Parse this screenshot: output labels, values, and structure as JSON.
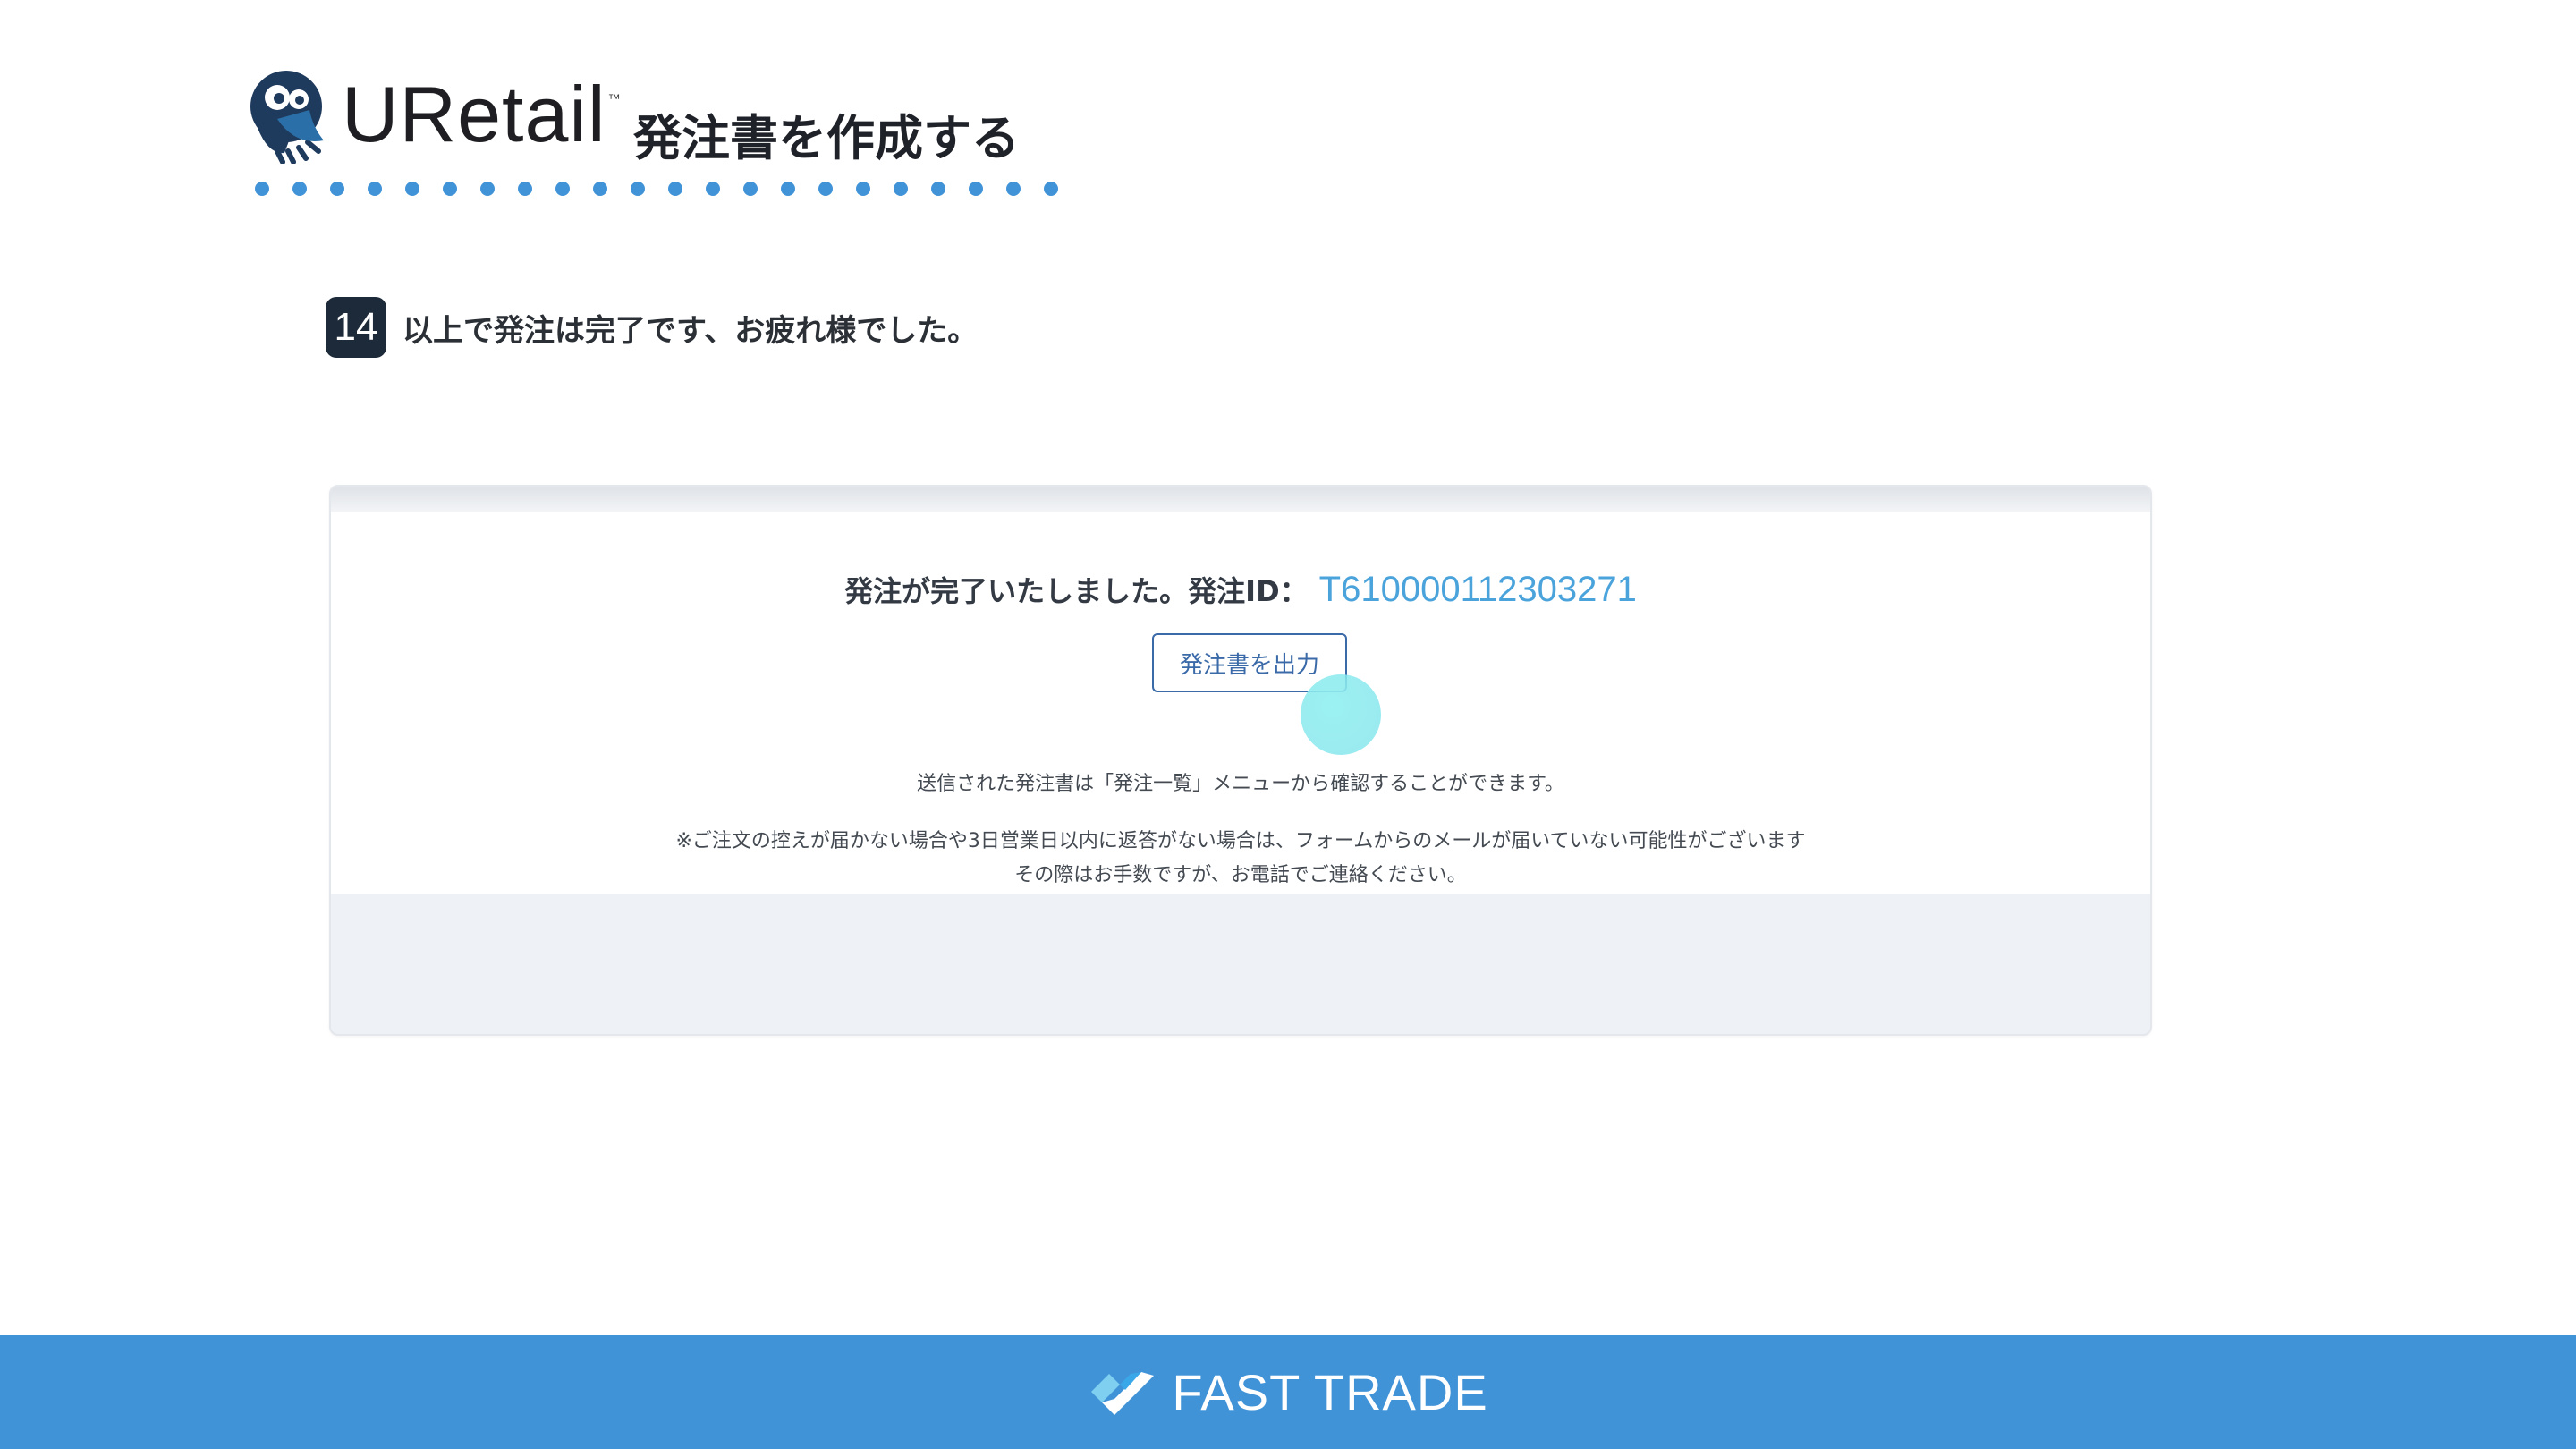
{
  "header": {
    "logo_text": "URetail",
    "logo_tm": "™",
    "title": "発注書を作成する"
  },
  "step": {
    "number": "14",
    "text": "以上で発注は完了です、お疲れ様でした。"
  },
  "screen": {
    "complete_label": "発注が完了いたしました。発注ID：",
    "order_id": "T610000112303271",
    "output_button_label": "発注書を出力",
    "info_line1": "送信された発注書は「発注一覧」メニューから確認することができます。",
    "info_line2": "※ご注文の控えが届かない場合や3日営業日以内に返答がない場合は、フォームからのメールが届いていない可能性がございます",
    "info_line3": "その際はお手数ですが、お電話でご連絡ください。"
  },
  "footer": {
    "brand": "FAST TRADE"
  },
  "colors": {
    "accent_blue": "#4193d8",
    "order_id": "#4aa3db",
    "badge": "#1d2a3a",
    "button_border": "#3b6aa8",
    "cursor": "#8fe8ea"
  }
}
